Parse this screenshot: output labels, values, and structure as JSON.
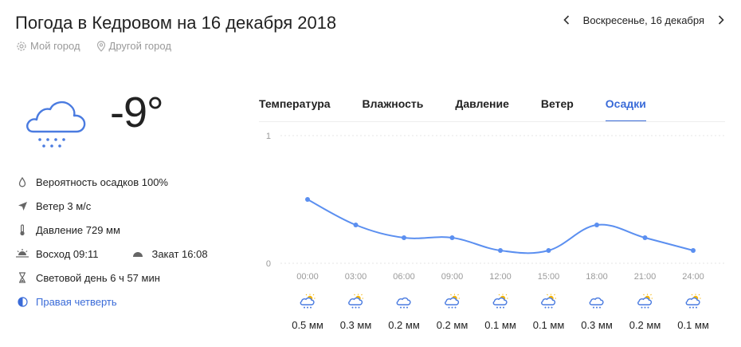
{
  "header": {
    "title": "Погода в Кедровом на 16 декабря 2018",
    "my_city": "Мой город",
    "other_city": "Другой город",
    "date": "Воскресенье, 16 декабря"
  },
  "current": {
    "temperature": "-9°",
    "icon": "cloud-snow-icon"
  },
  "details": {
    "precip": "Вероятность осадков 100%",
    "wind": "Ветер 3 м/с",
    "pressure": "Давление 729 мм",
    "sunrise": "Восход 09:11",
    "sunset": "Закат 16:08",
    "daylight": "Световой день 6 ч 57 мин",
    "moon": "Правая четверть"
  },
  "tabs": [
    {
      "label": "Температура",
      "active": false
    },
    {
      "label": "Влажность",
      "active": false
    },
    {
      "label": "Давление",
      "active": false
    },
    {
      "label": "Ветер",
      "active": false
    },
    {
      "label": "Осадки",
      "active": true
    }
  ],
  "colors": {
    "accent": "#3a6bd8",
    "line": "#5b8ff0",
    "icon_cloud": "#4a7be0",
    "sun": "#f5b400"
  },
  "chart_data": {
    "type": "line",
    "x": [
      "00:00",
      "03:00",
      "06:00",
      "09:00",
      "12:00",
      "15:00",
      "18:00",
      "21:00",
      "24:00"
    ],
    "values": [
      0.5,
      0.3,
      0.2,
      0.2,
      0.1,
      0.1,
      0.3,
      0.2,
      0.1
    ],
    "value_labels": [
      "0.5 мм",
      "0.3 мм",
      "0.2 мм",
      "0.2 мм",
      "0.1 мм",
      "0.1 мм",
      "0.3 мм",
      "0.2 мм",
      "0.1 мм"
    ],
    "point_icons": [
      "sun-cloud-snow-icon",
      "sun-cloud-snow-icon",
      "cloud-snow-icon",
      "sun-cloud-snow-icon",
      "sun-cloud-snow-icon",
      "sun-cloud-snow-icon",
      "cloud-snow-icon",
      "sun-cloud-snow-icon",
      "sun-cloud-snow-icon"
    ],
    "y_ticks": [
      "1",
      "0"
    ],
    "ylim": [
      0,
      1
    ],
    "grid": true
  }
}
